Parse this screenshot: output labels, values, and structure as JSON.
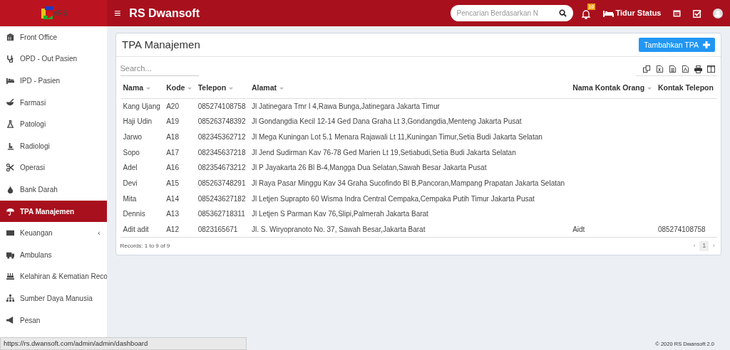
{
  "header": {
    "logo_text": "eRS",
    "menu_icon": "≡",
    "title": "RS Dwansoft",
    "search": {
      "placeholder": "Pencarian Berdasarkan N"
    },
    "notification_count": "10",
    "bed_status": "Tidur Status"
  },
  "sidebar": {
    "items": [
      {
        "label": "Front Office",
        "selected": false
      },
      {
        "label": "OPD - Out Pasien",
        "selected": false
      },
      {
        "label": "IPD - Pasien",
        "selected": false
      },
      {
        "label": "Farmasi",
        "selected": false
      },
      {
        "label": "Patologi",
        "selected": false
      },
      {
        "label": "Radiologi",
        "selected": false
      },
      {
        "label": "Operasi",
        "selected": false
      },
      {
        "label": "Bank Darah",
        "selected": false
      },
      {
        "label": "TPA Manajemen",
        "selected": true
      },
      {
        "label": "Keuangan",
        "selected": false,
        "expand_arrow": "‹"
      },
      {
        "label": "Ambulans",
        "selected": false
      },
      {
        "label": "Kelahiran & Kematian Reco",
        "selected": false
      },
      {
        "label": "Sumber Daya Manusia",
        "selected": false
      },
      {
        "label": "Pesan",
        "selected": false
      }
    ]
  },
  "panel": {
    "title": "TPA Manajemen",
    "add_button": "Tambahkan TPA",
    "search": {
      "placeholder": "Search..."
    },
    "table": {
      "columns": [
        {
          "label": "Nama",
          "sortable": true
        },
        {
          "label": "Kode",
          "sortable": true
        },
        {
          "label": "Telepon",
          "sortable": true
        },
        {
          "label": "Alamat",
          "sortable": true
        },
        {
          "label": "Nama Kontak Orang",
          "sortable": true
        },
        {
          "label": "Kontak Telepon",
          "sortable": false
        }
      ],
      "rows": [
        [
          "Kang Ujang",
          "A20",
          "085274108758",
          "Jl Jatinegara Tmr I 4,Rawa Bunga,Jatinegara Jakarta Timur",
          "",
          ""
        ],
        [
          "Haji Udin",
          "A19",
          "085263748392",
          "Jl Gondangdia Kecil 12-14 Ged Dana Graha Lt 3,Gondangdia,Menteng Jakarta Pusat",
          "",
          ""
        ],
        [
          "Jarwo",
          "A18",
          "082345362712",
          "Jl Mega Kuningan Lot 5.1 Menara Rajawali Lt 11,Kuningan Timur,Setia Budi Jakarta Selatan",
          "",
          ""
        ],
        [
          "Sopo",
          "A17",
          "082345637218",
          "Jl Jend Sudirman Kav 76-78 Ged Marien Lt 19,Setiabudi,Setia Budi Jakarta Selatan",
          "",
          ""
        ],
        [
          "Adel",
          "A16",
          "082354673212",
          "Jl P Jayakarta 26 Bl B-4,Mangga Dua Selatan,Sawah Besar Jakarta Pusat",
          "",
          ""
        ],
        [
          "Devi",
          "A15",
          "085263748291",
          "Jl Raya Pasar Minggu Kav 34 Graha Sucofindo Bl B,Pancoran,Mampang Prapatan Jakarta Selatan",
          "",
          ""
        ],
        [
          "Mita",
          "A14",
          "085243627182",
          "Jl Letjen Suprapto 60 Wisma Indra Central Cempaka,Cempaka Putih Timur Jakarta Pusat",
          "",
          ""
        ],
        [
          "Dennis",
          "A13",
          "085362718311",
          "Jl Letjen S Parman Kav 76,Slipi,Palmerah Jakarta Barat",
          "",
          ""
        ],
        [
          "Adit adit",
          "A12",
          "0823165671",
          "Jl. S. Wiryopranoto No. 37, Sawah Besar,Jakarta Barat",
          "Aidt",
          "085274108758"
        ]
      ]
    },
    "records": "Records: 1 to 9 of 9",
    "pagination": {
      "prev": "‹",
      "pages": [
        {
          "label": "1",
          "selected": true
        }
      ],
      "next": "›"
    }
  },
  "footer": {
    "copyright": "© 2020 RS Dwansoft 2.0"
  },
  "browser_status_url": "https://rs.dwansoft.com/admin/admin/dashboard"
}
